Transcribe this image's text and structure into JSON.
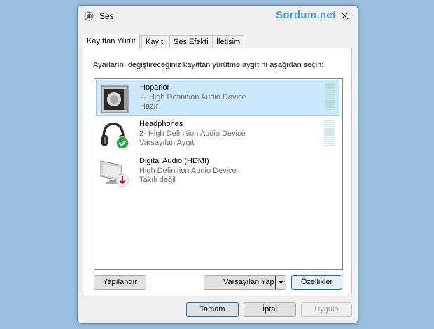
{
  "window": {
    "title": "Ses",
    "watermark": "Sordum.net"
  },
  "tabs": [
    {
      "label": "Kayıttan Yürüt",
      "active": true
    },
    {
      "label": "Kayıt",
      "active": false
    },
    {
      "label": "Ses Efekti",
      "active": false
    },
    {
      "label": "İletişim",
      "active": false
    }
  ],
  "panel": {
    "instruction": "Ayarlarını değiştireceğiniz kayıttan yürütme aygıtını aşağıdan seçin:"
  },
  "devices": [
    {
      "name": "Hoparlör",
      "driver": "2- High Definition Audio Device",
      "status": "Hazır",
      "icon": "speaker-icon",
      "selected": true
    },
    {
      "name": "Headphones",
      "driver": "2- High Definition Audio Device",
      "status": "Varsayılan Aygıt",
      "icon": "headphones-icon",
      "badge": "default-check-icon"
    },
    {
      "name": "Digital Audio (HDMI)",
      "driver": "High Definition Audio Device",
      "status": "Takılı değil",
      "icon": "monitor-icon",
      "badge": "unplugged-arrow-icon"
    }
  ],
  "buttons": {
    "configure": "Yapılandır",
    "set_default": "Varsayılan Yap",
    "properties": "Özellikler",
    "ok": "Tamam",
    "cancel": "İptal",
    "apply": "Uygula"
  },
  "colors": {
    "accent": "#0078d7",
    "selection": "#cce8ff",
    "watermark": "#3da0e6",
    "desktop": "#9bbfe0"
  }
}
